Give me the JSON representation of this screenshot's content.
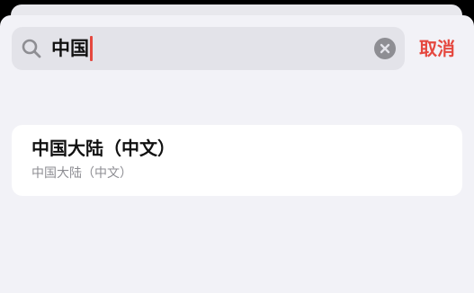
{
  "search": {
    "query": "中国",
    "cancel_label": "取消"
  },
  "icons": {
    "search": "magnifying-glass",
    "clear": "xmark-circle-fill"
  },
  "colors": {
    "accent": "#e5483f",
    "background": "#f2f2f7",
    "field": "#e3e3e9",
    "secondary_text": "#8e8e93"
  },
  "results": [
    {
      "title": "中国大陆（中文）",
      "subtitle": "中国大陆（中文）"
    }
  ]
}
